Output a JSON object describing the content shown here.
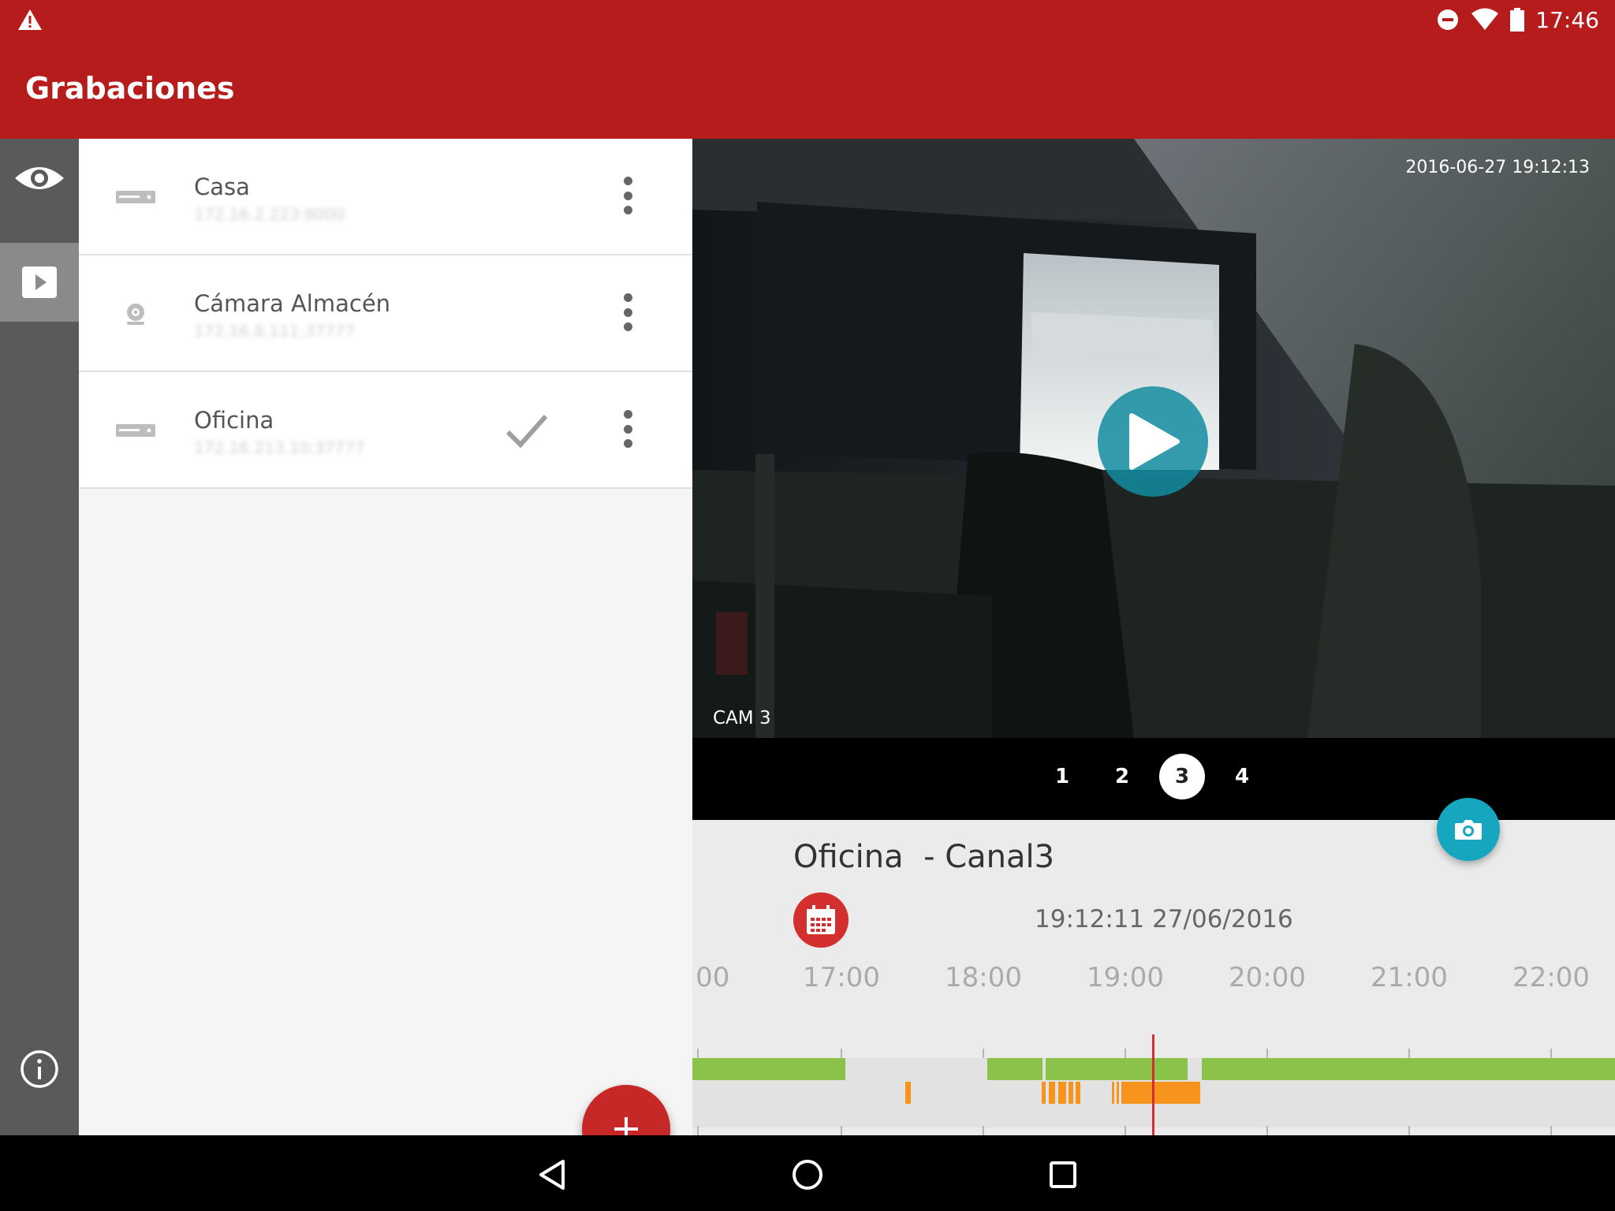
{
  "status_bar": {
    "time": "17:46",
    "icons": [
      "warning-icon",
      "do-not-disturb-icon",
      "wifi-icon",
      "battery-icon"
    ]
  },
  "app_bar": {
    "title": "Grabaciones"
  },
  "rail": {
    "items": [
      "eye-icon",
      "play-icon",
      "info-icon"
    ]
  },
  "devices": [
    {
      "name": "Casa",
      "address": "172.16.2.223:8000",
      "icon": "recorder-icon",
      "selected": false
    },
    {
      "name": "Cámara Almacén",
      "address": "172.16.8.111:37777",
      "icon": "webcam-icon",
      "selected": false
    },
    {
      "name": "Oficina",
      "address": "172.16.213.10:37777",
      "icon": "recorder-icon",
      "selected": true
    }
  ],
  "video": {
    "timestamp": "2016-06-27 19:12:13",
    "cam_label": "CAM 3",
    "channels": [
      "1",
      "2",
      "3",
      "4"
    ],
    "active_channel": "3"
  },
  "info": {
    "title": "Oficina  - Canal3",
    "datetime": "19:12:11 27/06/2016"
  },
  "timeline": {
    "labels": [
      ":00",
      "17:00",
      "18:00",
      "19:00",
      "20:00",
      "21:00",
      "22:00"
    ],
    "colors": {
      "continuous": "#8bc34a",
      "motion": "#f7941d",
      "cursor": "#d32f2f"
    }
  }
}
